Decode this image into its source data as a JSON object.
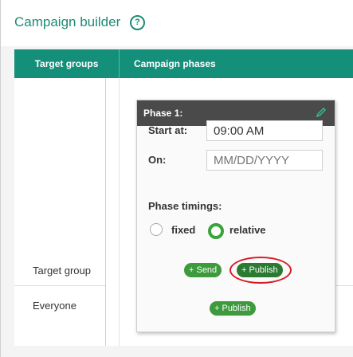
{
  "title": "Campaign builder",
  "help_icon": "?",
  "headers": {
    "target_groups": "Target groups",
    "campaign_phases": "Campaign phases"
  },
  "phase": {
    "title": "Phase 1:",
    "start_label": "Start at:",
    "start_value": "09:00 AM",
    "on_label": "On:",
    "on_placeholder": "MM/DD/YYYY",
    "timings_label": "Phase timings:",
    "timing_options": [
      {
        "label": "fixed",
        "selected": false
      },
      {
        "label": "relative",
        "selected": true
      }
    ]
  },
  "rows": [
    {
      "label": "Target group",
      "buttons": [
        "+ Send",
        "+ Publish"
      ]
    },
    {
      "label": "Everyone",
      "buttons": [
        "+ Publish"
      ]
    }
  ],
  "colors": {
    "accent": "#138f7a",
    "button_green": "#3d9a3d",
    "highlight_red": "#d81b23"
  }
}
